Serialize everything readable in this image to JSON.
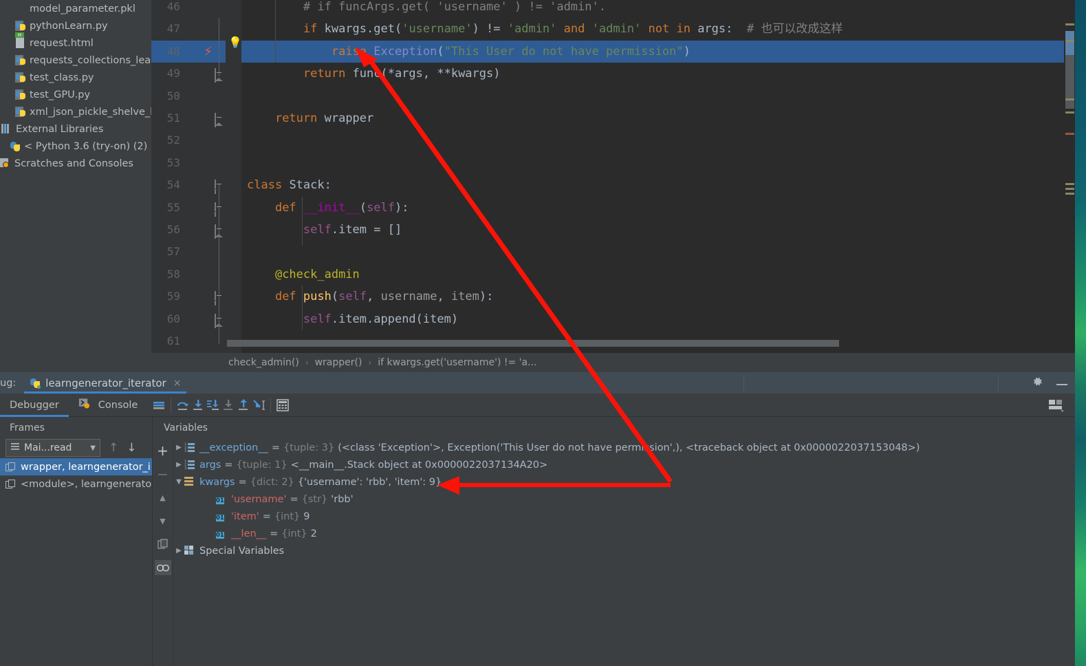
{
  "project_tree": {
    "items": [
      {
        "label": "model_parameter.pkl",
        "icon": "file-icon",
        "indent": 22
      },
      {
        "label": "pythonLearn.py",
        "icon": "python-file-icon",
        "indent": 22
      },
      {
        "label": "request.html",
        "icon": "html-file-icon",
        "indent": 22
      },
      {
        "label": "requests_collections_learn",
        "icon": "python-file-icon",
        "indent": 22
      },
      {
        "label": "test_class.py",
        "icon": "python-file-icon",
        "indent": 22
      },
      {
        "label": "test_GPU.py",
        "icon": "python-file-icon",
        "indent": 22
      },
      {
        "label": "xml_json_pickle_shelve_le",
        "icon": "python-file-icon",
        "indent": 22
      },
      {
        "label": "External Libraries",
        "icon": "libraries-icon",
        "indent": 2
      },
      {
        "label": "< Python 3.6 (try-on) (2) >",
        "icon": "python-interpreter-icon",
        "indent": 14
      },
      {
        "label": "Scratches and Consoles",
        "icon": "scratches-icon",
        "indent": 0
      }
    ]
  },
  "editor": {
    "lines": [
      {
        "num": "46",
        "fold": "none",
        "html": "<span class=\"cmt\">        # if funcArgs.get( 'username' ) != 'admin'.</span>"
      },
      {
        "num": "47",
        "fold": "none",
        "html": "        <span class=\"kw\">if</span> kwargs.get(<span class=\"str\">'username'</span>) != <span class=\"str\">'admin'</span> <span class=\"kw\">and</span> <span class=\"str\">'admin'</span> <span class=\"kw\">not in</span> args:  <span class=\"cmt\"># 也可以改成这样</span>"
      },
      {
        "num": "48",
        "fold": "none",
        "html": "            <span class=\"kw\">raise</span> <span class=\"exc\">Exception</span>(<span class=\"str\">\"This User do not have permission\"</span>)",
        "highlight": true
      },
      {
        "num": "49",
        "fold": "end",
        "html": "        <span class=\"kw\">return</span> func(*args, **kwargs)"
      },
      {
        "num": "50",
        "fold": "none",
        "html": ""
      },
      {
        "num": "51",
        "fold": "end",
        "html": "    <span class=\"kw\">return</span> wrapper"
      },
      {
        "num": "52",
        "fold": "none",
        "html": ""
      },
      {
        "num": "53",
        "fold": "none",
        "html": ""
      },
      {
        "num": "54",
        "fold": "start",
        "html": "<span class=\"kw\">class</span> <span class=\"cls\">Stack</span>:"
      },
      {
        "num": "55",
        "fold": "start",
        "html": "    <span class=\"kw\">def</span> <span class=\"dunder\">__init__</span>(<span class=\"self\">self</span>):"
      },
      {
        "num": "56",
        "fold": "end",
        "html": "        <span class=\"self\">self</span>.item = []"
      },
      {
        "num": "57",
        "fold": "none",
        "html": ""
      },
      {
        "num": "58",
        "fold": "none",
        "html": "    <span class=\"deco\">@check_admin</span>"
      },
      {
        "num": "59",
        "fold": "start",
        "html": "    <span class=\"kw\">def</span> <span class=\"fn\">push</span>(<span class=\"self\">self</span>, <span class=\"param\">username</span>, <span class=\"param\">item</span>):"
      },
      {
        "num": "60",
        "fold": "end",
        "html": "        <span class=\"self\">self</span>.item.append(item)"
      },
      {
        "num": "61",
        "fold": "none",
        "html": ""
      }
    ],
    "gutter_bolt_line": "48",
    "bulb_icon": "lightbulb-icon"
  },
  "breadcrumb": {
    "items": [
      "check_admin()",
      "wrapper()",
      "if kwargs.get('username') != 'a..."
    ],
    "separator": "›"
  },
  "debug": {
    "panel_label": "ug:",
    "tab_name": "learngenerator_iterator",
    "tab_close": "×",
    "tab_icon": "python-run-config-icon",
    "header_icons": [
      "gear-icon",
      "minimize-icon"
    ],
    "toolbar": {
      "tabs": [
        {
          "label": "Debugger",
          "icon": null,
          "active": true
        },
        {
          "label": "Console",
          "icon": "console-icon",
          "active": false
        }
      ],
      "buttons": [
        {
          "name": "mute-breakpoints-icon"
        },
        {
          "name": "step-over-icon"
        },
        {
          "name": "step-into-icon"
        },
        {
          "name": "force-step-into-icon"
        },
        {
          "name": "step-into-my-code-icon"
        },
        {
          "name": "step-out-icon"
        },
        {
          "name": "run-to-cursor-icon"
        },
        {
          "name": "evaluate-expression-icon"
        }
      ],
      "layout_icon": "layout-settings-icon"
    },
    "frames": {
      "title": "Frames",
      "thread_select": "Mai...read",
      "thread_icon": "thread-icon",
      "up_icon": "arrow-up-icon",
      "down_icon": "arrow-down-icon",
      "rows": [
        {
          "label": "wrapper, learngenerator_i",
          "selected": true
        },
        {
          "label": "<module>, learngenerato",
          "selected": false
        }
      ]
    },
    "variables": {
      "title": "Variables",
      "side_buttons": [
        {
          "name": "add-watch-icon",
          "glyph": "+"
        },
        {
          "name": "remove-watch-icon",
          "glyph": "−"
        },
        {
          "name": "move-up-icon",
          "glyph": "▲"
        },
        {
          "name": "move-down-icon",
          "glyph": "▼"
        },
        {
          "name": "copy-value-icon",
          "glyph": "⧉"
        },
        {
          "name": "watches-icon",
          "glyph": "∞",
          "active": true
        }
      ],
      "rows": [
        {
          "arrow": "▶",
          "icon": "tuple-icon",
          "indent": 0,
          "name": "__exception__",
          "name_color": "blue",
          "type": "{tuple: 3}",
          "value": "(<class 'Exception'>, Exception('This User do not have permission',), <traceback object at 0x0000022037153048>)"
        },
        {
          "arrow": "▶",
          "icon": "tuple-icon",
          "indent": 0,
          "name": "args",
          "name_color": "blue",
          "type": "{tuple: 1}",
          "value": "<__main__.Stack object at 0x0000022037134A20>"
        },
        {
          "arrow": "▼",
          "icon": "dict-icon",
          "indent": 0,
          "name": "kwargs",
          "name_color": "blue",
          "type": "{dict: 2}",
          "value": "{'username': 'rbb', 'item': 9}"
        },
        {
          "arrow": "",
          "icon": "primitive-icon",
          "indent": 1,
          "name": "'username'",
          "name_color": "red",
          "type": "{str}",
          "value": "'rbb'"
        },
        {
          "arrow": "",
          "icon": "primitive-icon",
          "indent": 1,
          "name": "'item'",
          "name_color": "red",
          "type": "{int}",
          "value": "9"
        },
        {
          "arrow": "",
          "icon": "primitive-icon",
          "indent": 1,
          "name": "__len__",
          "name_color": "red",
          "type": "{int}",
          "value": "2"
        },
        {
          "arrow": "▶",
          "icon": "special-variables-icon",
          "indent": 0,
          "name": "Special Variables",
          "name_color": "plain",
          "type": "",
          "value": ""
        }
      ]
    }
  },
  "annotations": {
    "arrow1": {
      "name": "red-arrow-to-raise-line",
      "color": "#fc1308"
    },
    "arrow2": {
      "name": "red-arrow-to-kwargs-value",
      "color": "#fc1308"
    }
  },
  "colors": {
    "accent_blue": "#3b84d0",
    "selection_blue": "#2f5c94",
    "frame_selection": "#3b6ea5",
    "editor_bg": "#2b2b2b",
    "panel_bg": "#3c3f41",
    "annotation_red": "#fc1308"
  }
}
